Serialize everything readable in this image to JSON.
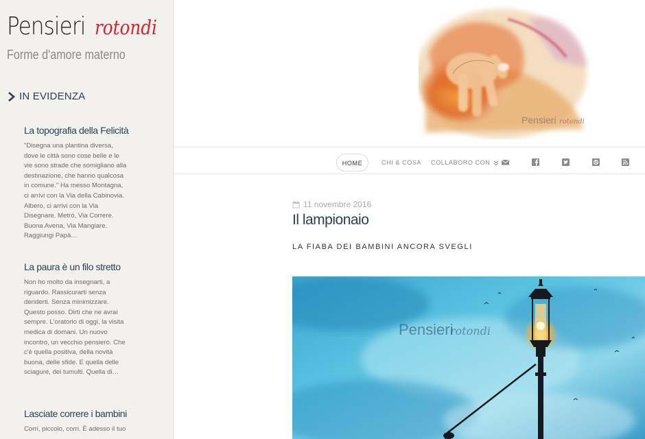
{
  "site": {
    "title_main": "Pensieri",
    "title_accent": "rotondi",
    "tagline": "Forme d'amore materno"
  },
  "sidebar": {
    "section_label": "IN EVIDENZA",
    "posts": [
      {
        "title": "La topografia della Felicità",
        "excerpt": "\"Disegna una plantina diversa, dove le città sono cose belle e le vie sono strade che somigliano alla destinazione, che hanno qualcosa in comune.\" Ha messo Montagna, ci arrivi con la Via della Cabinovia. Albero, ci arrivi con la Via Disegnare. Metrò, Via Correre. Buona Avena, Via Mangiare. Raggiungi Papà…"
      },
      {
        "title": "La paura è un filo stretto",
        "excerpt": "Non ho molto da insegnarti, a riguardo. Rassicurarti senza deriderti. Senza minimizzare. Questo posso. Dirti che ne avrai sempre. L'oratorio di oggi, la visita medica di domani. Un nuovo incontro, un vecchio pensiero. Che c'è quella positiva, della novità buona, delle sfide. E quella delle sciagure, dei tumulti. Quella di…"
      },
      {
        "title": "Lasciate correre i bambini",
        "excerpt": "Corri, piccolo, corri. È adesso il tuo"
      }
    ]
  },
  "banner": {
    "watermark_main": "Pensieri",
    "watermark_accent": "rotondi"
  },
  "nav": {
    "items": [
      "HOME",
      "CHI & COSA",
      "COLLABORO CON"
    ],
    "icons": [
      "envelope-icon",
      "facebook-icon",
      "twitter-icon",
      "skype-icon",
      "rss-icon"
    ]
  },
  "article": {
    "date": "11 novembre 2016",
    "title": "Il lampionaio",
    "subtitle": "LA FIABA DEI BAMBINI ANCORA SVEGLI",
    "watermark_main": "Pensieri",
    "watermark_accent": "rotondi"
  },
  "colors": {
    "accent": "#d4232e",
    "heading": "#2c3e50",
    "sidebar_bg": "#f3f1ee"
  }
}
